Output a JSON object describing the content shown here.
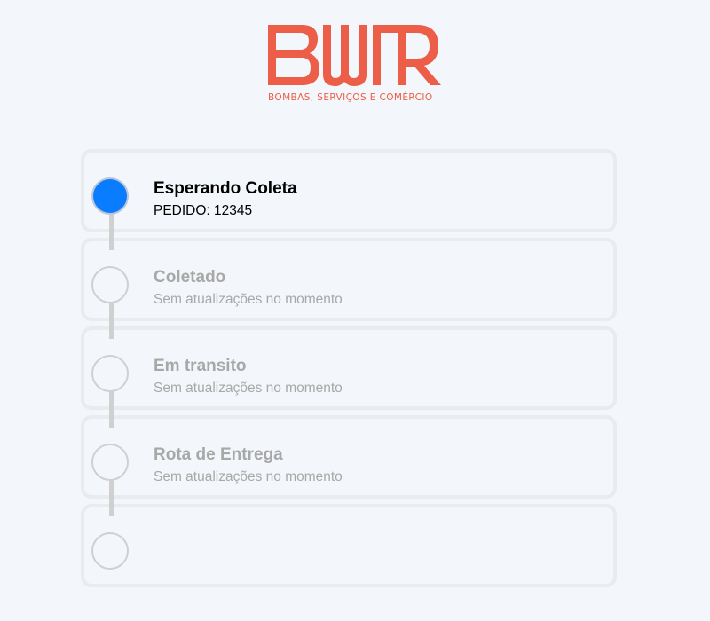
{
  "brand": {
    "name": "BWR",
    "tagline": "BOMBAS, SERVIÇOS E COMÉRCIO",
    "color": "#ec5e47"
  },
  "tracking": {
    "steps": [
      {
        "title": "Esperando Coleta",
        "subtitle": "PEDIDO: 12345",
        "status": "active"
      },
      {
        "title": "Coletado",
        "subtitle": "Sem atualizações no momento",
        "status": "pending"
      },
      {
        "title": "Em transito",
        "subtitle": "Sem atualizações no momento",
        "status": "pending"
      },
      {
        "title": "Rota de Entrega",
        "subtitle": "Sem atualizações no momento",
        "status": "pending"
      },
      {
        "title": "",
        "subtitle": "",
        "status": "pending"
      }
    ],
    "active_color": "#0a7cff",
    "inactive_color": "#a8a8a8"
  }
}
